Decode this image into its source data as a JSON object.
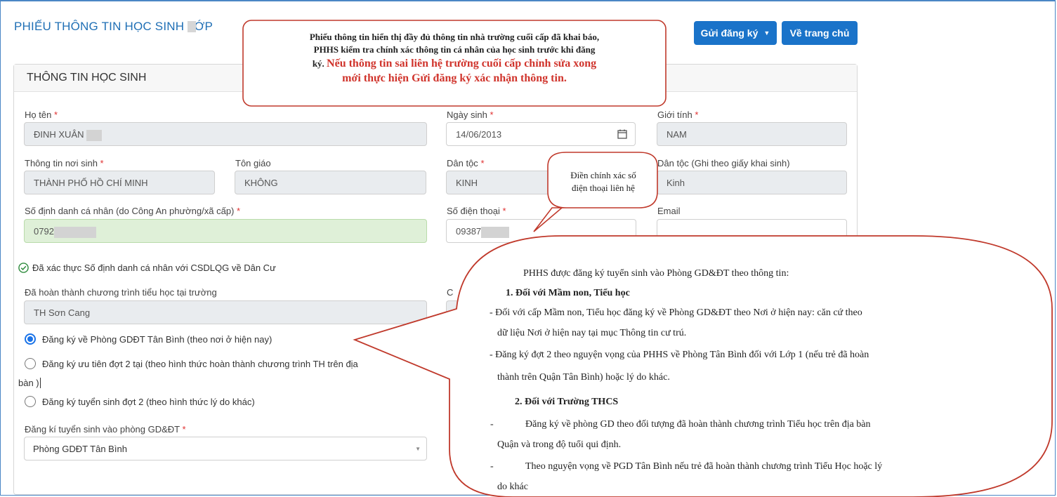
{
  "header": {
    "title": "PHIẾU THÔNG TIN HỌC SINH LỚP",
    "send_button": "Gửi đăng ký",
    "home_button": "Về trang chủ"
  },
  "card": {
    "title": "THÔNG TIN HỌC SINH"
  },
  "fields": {
    "ho_ten": {
      "label": "Họ tên",
      "value": "ĐINH XUÂN"
    },
    "ngay_sinh": {
      "label": "Ngày sinh",
      "value": "14/06/2013"
    },
    "gioi_tinh": {
      "label": "Giới tính",
      "value": "NAM"
    },
    "noi_sinh": {
      "label": "Thông tin nơi sinh",
      "value": "THÀNH PHỐ HỒ CHÍ MINH"
    },
    "ton_giao": {
      "label": "Tôn giáo",
      "value": "KHÔNG"
    },
    "dan_toc": {
      "label": "Dân tộc",
      "value": "KINH"
    },
    "dan_toc_gks": {
      "label": "Dân tộc (Ghi theo giấy khai sinh)",
      "value": "Kinh"
    },
    "dinh_danh": {
      "label": "Số định danh cá nhân (do Công An phường/xã cấp)",
      "value": "0792"
    },
    "so_dien_thoai": {
      "label": "Số điện thoại",
      "value": "09387"
    },
    "email": {
      "label": "Email",
      "value": ""
    },
    "verified_text": "Đã xác thực Số định danh cá nhân với CSDLQG về Dân Cư",
    "truong_tieu_hoc": {
      "label": "Đã hoàn thành chương trình tiểu học tại trường",
      "value": "TH Sơn Cang"
    },
    "hidden_label_fragment": "C",
    "dang_ki_phong": {
      "label": "Đăng kí tuyển sinh vào phòng GD&ĐT",
      "value": "Phòng GDĐT Tân Bình"
    }
  },
  "radios": [
    {
      "label": "Đăng ký về Phòng GDĐT Tân Bình (theo nơi ở hiện nay)",
      "selected": true
    },
    {
      "label": "Đăng ký ưu tiên đợt 2 tại (theo hình thức hoàn thành chương trình TH trên địa",
      "label_cont": "bàn )",
      "selected": false
    },
    {
      "label": "Đăng ký tuyển sinh đợt 2 (theo hình thức lý do khác)",
      "selected": false
    }
  ],
  "callouts": {
    "top": {
      "line1": "Phiếu thông tin hiển thị đầy đủ thông tin nhà trường cuối cấp đã khai báo,",
      "line2": "PHHS kiểm tra chính xác thông tin cá nhân của học sinh trước khi đăng",
      "line3": "ký.",
      "red1": "Nếu thông tin sai liên hệ trường cuối cấp chỉnh sửa xong",
      "red2": "mới thực hiện Gửi đăng ký xác nhận thông tin."
    },
    "phone": {
      "line1": "Điền chính xác số",
      "line2": "điện thoại liên hệ"
    },
    "big": {
      "intro": "PHHS được đăng ký tuyển sinh vào Phòng GD&ĐT theo thông tin:",
      "h1": "1.  Đối với Mầm non, Tiểu học",
      "p1a": "- Đối với cấp Mầm non, Tiểu học đăng ký về Phòng GD&ĐT theo Nơi ở hiện nay: căn cứ theo",
      "p1b": "dữ liệu Nơi ở hiện nay tại mục Thông tin cư trú.",
      "p2a": "- Đăng ký đợt 2 theo nguyện vọng của PHHS về Phòng Tân Bình đối với Lớp 1 (nếu trẻ đã hoàn",
      "p2b": "thành trên Quận Tân Bình) hoặc lý do khác.",
      "h2": "2.  Đối với Trường THCS",
      "p3a": "Đăng ký về phòng GD theo đối tượng đã hoàn thành chương trình  Tiểu học trên địa bàn",
      "p3b": "Quận và trong độ tuổi qui định.",
      "p4a": "Theo nguyện vọng về PGD Tân Bình nếu trẻ đã hoàn thành chương trình Tiểu Học hoặc lý",
      "p4b": "do khác",
      "dash": "-"
    }
  },
  "colors": {
    "accent": "#1a73c9",
    "required": "#e03131",
    "callout_border": "#c0392b",
    "callout_red_text": "#d0342c",
    "verified_green": "#2e8b3d"
  }
}
